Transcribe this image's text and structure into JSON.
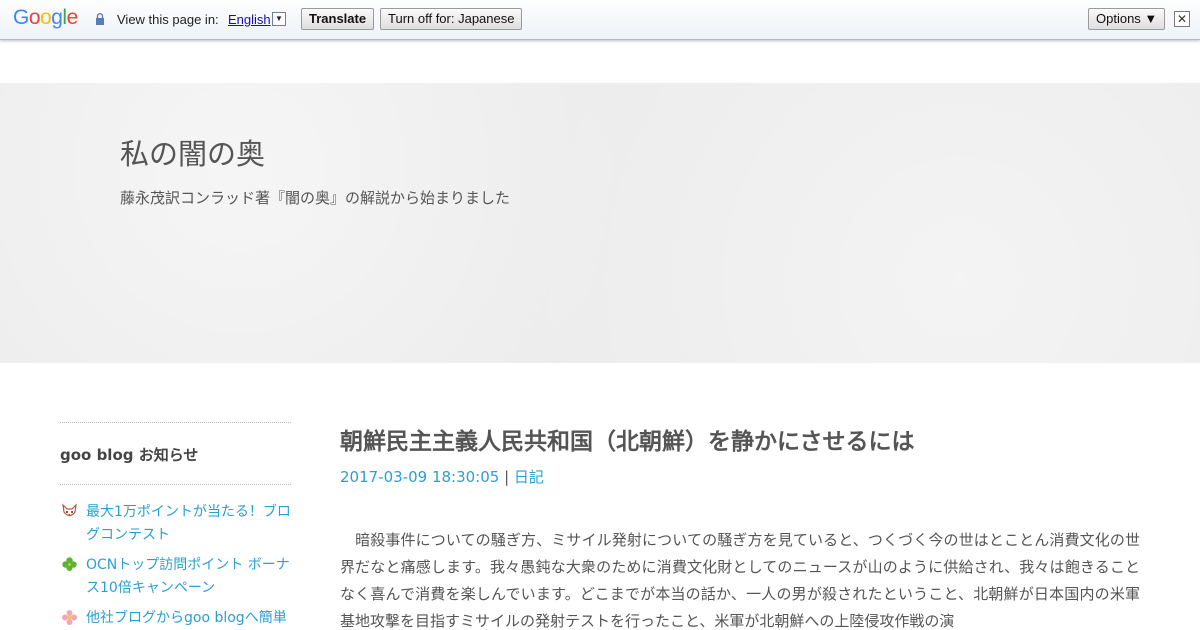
{
  "translate_bar": {
    "logo": "Google",
    "view_in_label": "View this page in:",
    "language": "English",
    "translate_button": "Translate",
    "turn_off_button": "Turn off for: Japanese",
    "options_button": "Options ▼",
    "close_label": "✕"
  },
  "header": {
    "title": "私の闇の奥",
    "description": "藤永茂訳コンラッド著『闇の奥』の解説から始まりました"
  },
  "sidebar": {
    "heading": "goo blog お知らせ",
    "items": [
      {
        "icon": "fox-icon",
        "label": "最大1万ポイントが当たる！ブログコンテスト"
      },
      {
        "icon": "clover-icon",
        "label": "OCNトップ訪問ポイント ボーナス10倍キャンペーン"
      },
      {
        "icon": "flower-icon",
        "label": "他社ブログからgoo blogへ簡単"
      }
    ]
  },
  "article": {
    "title": "朝鮮民主主義人民共和国（北朝鮮）を静かにさせるには",
    "datetime": "2017-03-09 18:30:05",
    "separator": " | ",
    "category": "日記",
    "body": "　暗殺事件についての騒ぎ方、ミサイル発射についての騒ぎ方を見ていると、つくづく今の世はとことん消費文化の世界だなと痛感します。我々愚鈍な大衆のために消費文化財としてのニュースが山のように供給され、我々は飽きることなく喜んで消費を楽しんでいます。どこまでが本当の話か、一人の男が殺されたということ、北朝鮮が日本国内の米軍基地攻撃を目指すミサイルの発射テストを行ったこと、米軍が北朝鮮への上陸侵攻作戦の演"
  },
  "colors": {
    "link": "#2a9fd6",
    "text": "#555555",
    "header_bg": "#ececec"
  }
}
